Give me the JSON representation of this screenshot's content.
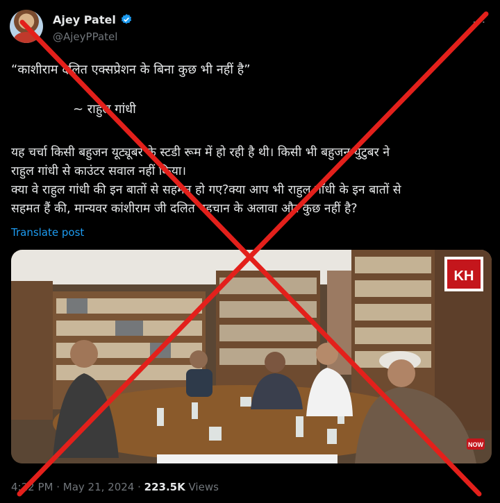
{
  "user": {
    "display_name": "Ajey Patel",
    "handle": "@AjeyPPatel",
    "verified_icon": "verified-badge-icon",
    "more_label": "···"
  },
  "tweet": {
    "quote": "“काशीराम दलित एक्सप्रेशन के बिना कुछ भी नहीं है”",
    "quote_author": "~ राहुल गांधी",
    "body_lines": [
      "यह चर्चा किसी बहुजन यूट्यूबर के स्टडी रूम में हो रही है थी। किसी भी बहुजन युटुबर ने",
      "राहुल गांधी से काउंटर सवाल नहीं किया।",
      "क्या वे राहुल गांधी की इन बातों से सहमत हो गए?क्या आप भी राहुल गाँधी के इन बातों से",
      "सहमत हैं की, मान्यवर कांशीराम जी दलित पहचान के अलावा और कुछ नहीं है?"
    ],
    "translate_label": "Translate post"
  },
  "media": {
    "channel_logo_text": "KH",
    "live_badge": "NOW"
  },
  "footer": {
    "time": "4:22 PM",
    "separator": " · ",
    "date": "May 21, 2024",
    "views_count": "223.5K",
    "views_label": " Views"
  },
  "colors": {
    "accent": "#1d9bf0",
    "cross": "#e3201b",
    "muted": "#71767b"
  }
}
